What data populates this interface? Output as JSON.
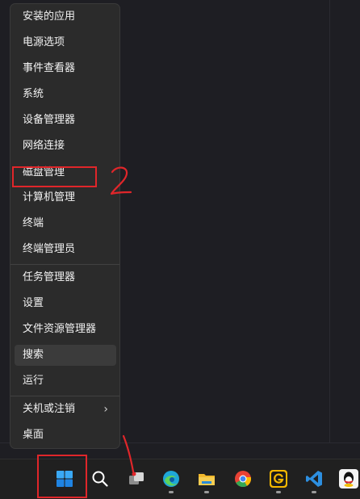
{
  "context_menu": {
    "items": [
      {
        "label": "安装的应用"
      },
      {
        "label": "电源选项"
      },
      {
        "label": "事件查看器"
      },
      {
        "label": "系统"
      },
      {
        "label": "设备管理器"
      },
      {
        "label": "网络连接"
      },
      {
        "label": "磁盘管理"
      },
      {
        "label": "计算机管理"
      },
      {
        "label": "终端"
      },
      {
        "label": "终端管理员"
      },
      {
        "label": "任务管理器"
      },
      {
        "label": "设置"
      },
      {
        "label": "文件资源管理器"
      },
      {
        "label": "搜索",
        "state": "hovered"
      },
      {
        "label": "运行"
      },
      {
        "label": "关机或注销",
        "submenu": true,
        "submenu_icon": "chevron-right-icon"
      },
      {
        "label": "桌面"
      }
    ]
  },
  "taskbar": {
    "icons": [
      {
        "name": "start-icon",
        "color": "#2b9af3"
      },
      {
        "name": "search-icon",
        "color": "#ffffff"
      },
      {
        "name": "task-view-icon",
        "color": "#cfcfcf"
      },
      {
        "name": "edge-icon",
        "color": "#1fa7d8"
      },
      {
        "name": "file-explorer-icon",
        "color": "#f2b82b"
      },
      {
        "name": "chrome-icon",
        "color": "#e94235"
      },
      {
        "name": "app-g-icon",
        "color": "#f5b800"
      },
      {
        "name": "vscode-icon",
        "color": "#2d8fe0"
      },
      {
        "name": "qq-icon",
        "color": "#111111"
      }
    ]
  },
  "annotations": {
    "color": "#e0262a",
    "number_label": "2"
  }
}
